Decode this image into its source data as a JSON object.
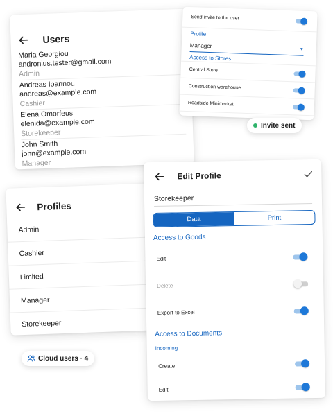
{
  "users_screen": {
    "title": "Users",
    "users": [
      {
        "name": "Maria Georgiou",
        "email": "andronius.tester@gmail.com",
        "role": "Admin"
      },
      {
        "name": "Andreas Ioannou",
        "email": "andreas@example.com",
        "role": "Cashier"
      },
      {
        "name": "Elena Omorfeus",
        "email": "elenida@example.com",
        "role": "Storekeeper"
      },
      {
        "name": "John Smith",
        "email": "john@example.com",
        "role": "Manager"
      }
    ]
  },
  "invite_screen": {
    "send_invite_label": "Send invite to the user",
    "send_invite_on": true,
    "profile_label": "Profile",
    "profile_value": "Manager",
    "stores_section": "Access to Stores",
    "stores": [
      {
        "name": "Central Store",
        "on": true
      },
      {
        "name": "Construction warehouse",
        "on": true
      },
      {
        "name": "Roadside Minimarket",
        "on": true
      }
    ]
  },
  "invite_badge": {
    "text": "Invite sent",
    "status_color": "#2fb36b"
  },
  "profiles_screen": {
    "title": "Profiles",
    "items": [
      "Admin",
      "Cashier",
      "Limited",
      "Manager",
      "Storekeeper"
    ]
  },
  "cloud_badge": {
    "text": "Cloud users · 4",
    "icon": "users-icon"
  },
  "edit_profile": {
    "title": "Edit Profile",
    "profile_name": "Storekeeper",
    "tabs": [
      "Data",
      "Print"
    ],
    "active_tab": "Data",
    "goods_section": "Access to Goods",
    "goods": [
      {
        "label": "Edit",
        "on": true,
        "disabled": false
      },
      {
        "label": "Delete",
        "on": false,
        "disabled": true
      },
      {
        "label": "Export to Excel",
        "on": true,
        "disabled": false
      }
    ],
    "documents_section": "Access to Documents",
    "incoming_label": "Incoming",
    "documents": [
      {
        "label": "Create",
        "on": true
      },
      {
        "label": "Edit",
        "on": true
      }
    ]
  },
  "colors": {
    "accent": "#1565c0",
    "toggle_on": "#1e78d8",
    "muted": "#9b9b9b"
  }
}
